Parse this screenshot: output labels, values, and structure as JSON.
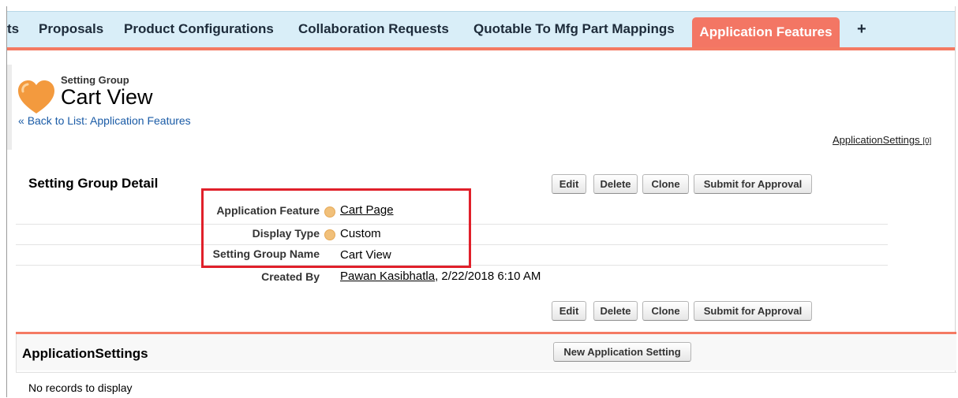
{
  "tabs": [
    {
      "label": "ts"
    },
    {
      "label": "Proposals"
    },
    {
      "label": "Product Configurations"
    },
    {
      "label": "Collaboration Requests"
    },
    {
      "label": "Quotable To Mfg Part Mappings"
    }
  ],
  "active_tab": "Application Features",
  "plus_tab": "+",
  "header": {
    "pretitle": "Setting Group",
    "title": "Cart View",
    "back_prefix": "« ",
    "back_link": "Back to List: Application Features",
    "related_link": "ApplicationSettings",
    "related_count": "[0]"
  },
  "detail": {
    "section_title": "Setting Group Detail",
    "buttons": [
      "Edit",
      "Delete",
      "Clone",
      "Submit for Approval"
    ],
    "fields": [
      {
        "label": "Application Feature",
        "value": "Cart Page"
      },
      {
        "label": "Display Type",
        "value": "Custom"
      },
      {
        "label": "Setting Group Name",
        "value": "Cart View"
      },
      {
        "label": "Created By",
        "value_link": "Pawan Kasibhatla",
        "value_rest": ", 2/22/2018 6:10 AM"
      }
    ]
  },
  "related_list": {
    "title": "ApplicationSettings",
    "new_button": "New Application Setting",
    "empty_text": "No records to display"
  },
  "colors": {
    "tab_bar": "#d9eef8",
    "accent": "#f47a63",
    "link": "#1a5ba6",
    "highlight_box": "#e0202a"
  }
}
